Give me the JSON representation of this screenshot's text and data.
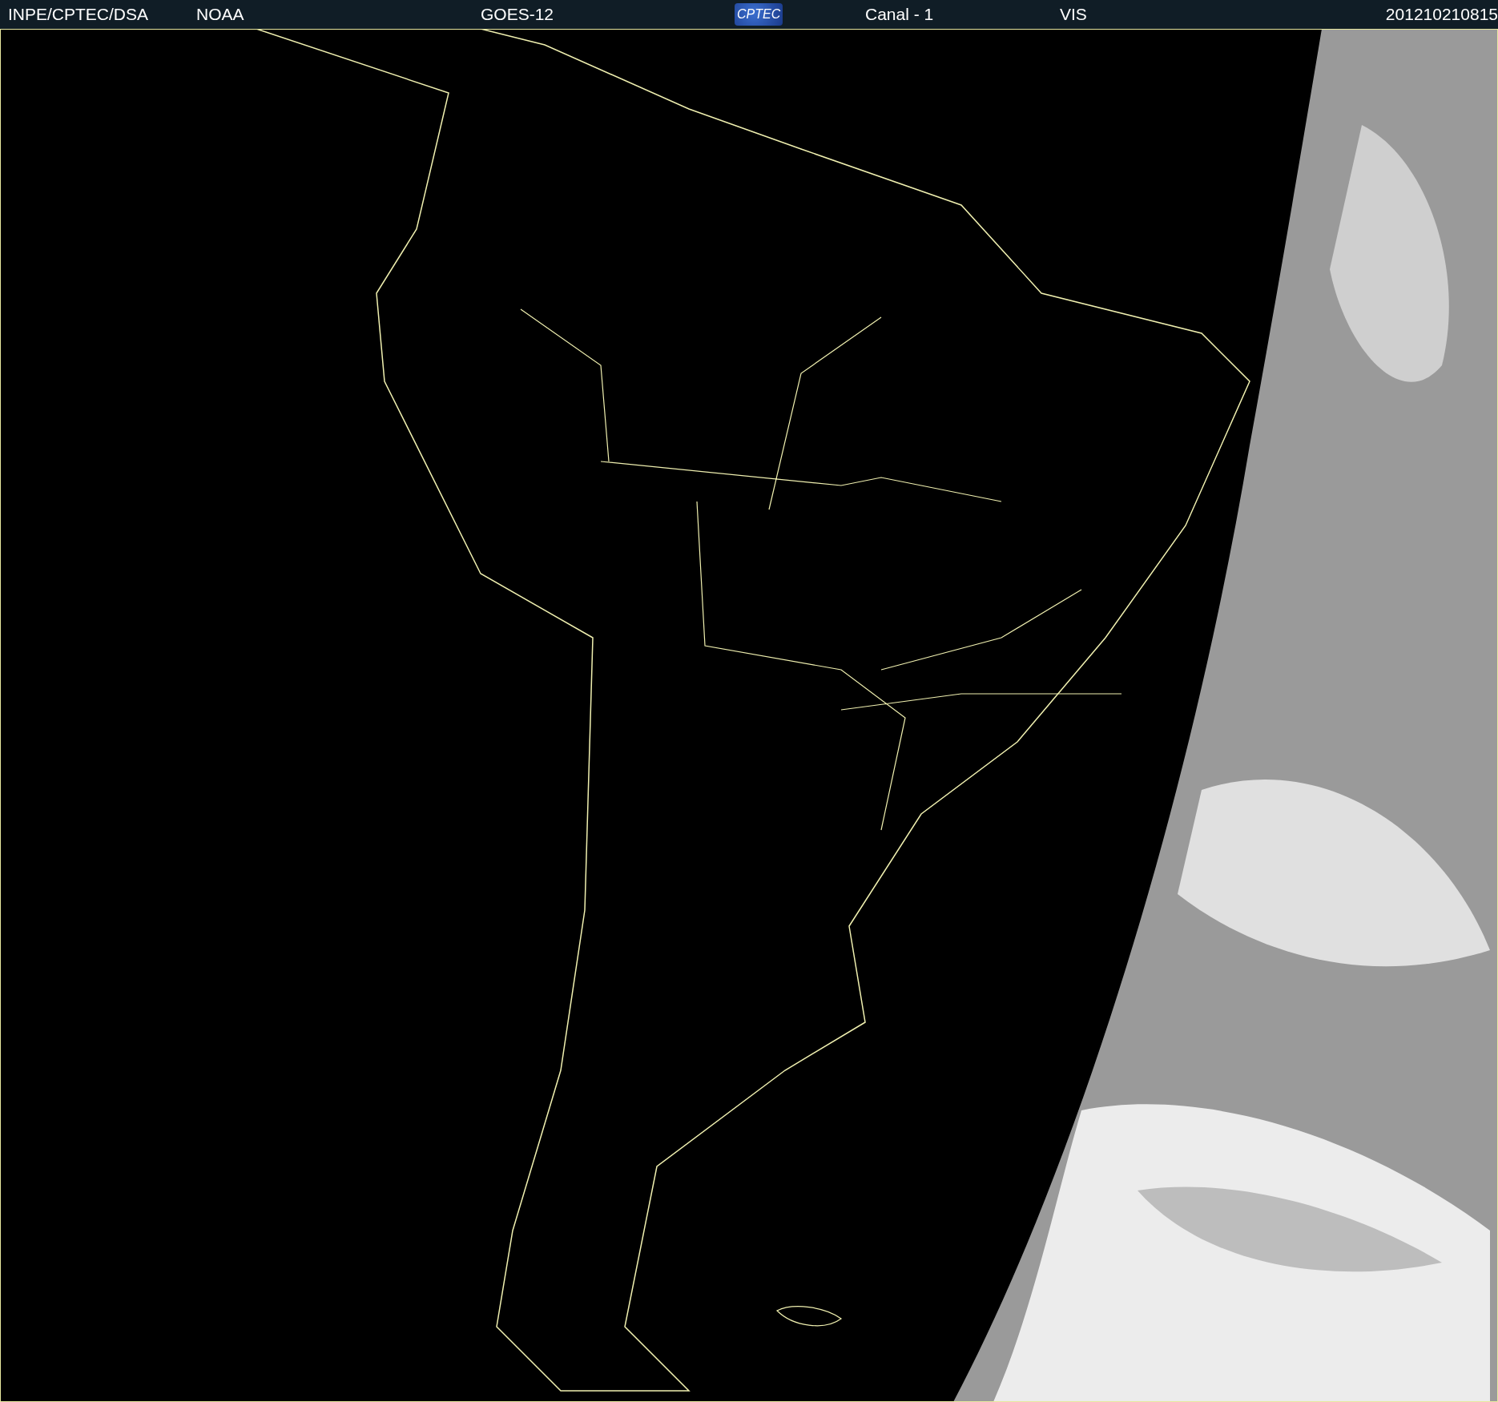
{
  "header": {
    "agency": "INPE/CPTEC/DSA",
    "source": "NOAA",
    "satellite": "GOES-12",
    "logo_text": "CPTEC",
    "channel": "Canal - 1",
    "band": "VIS",
    "timestamp": "201210210815"
  }
}
